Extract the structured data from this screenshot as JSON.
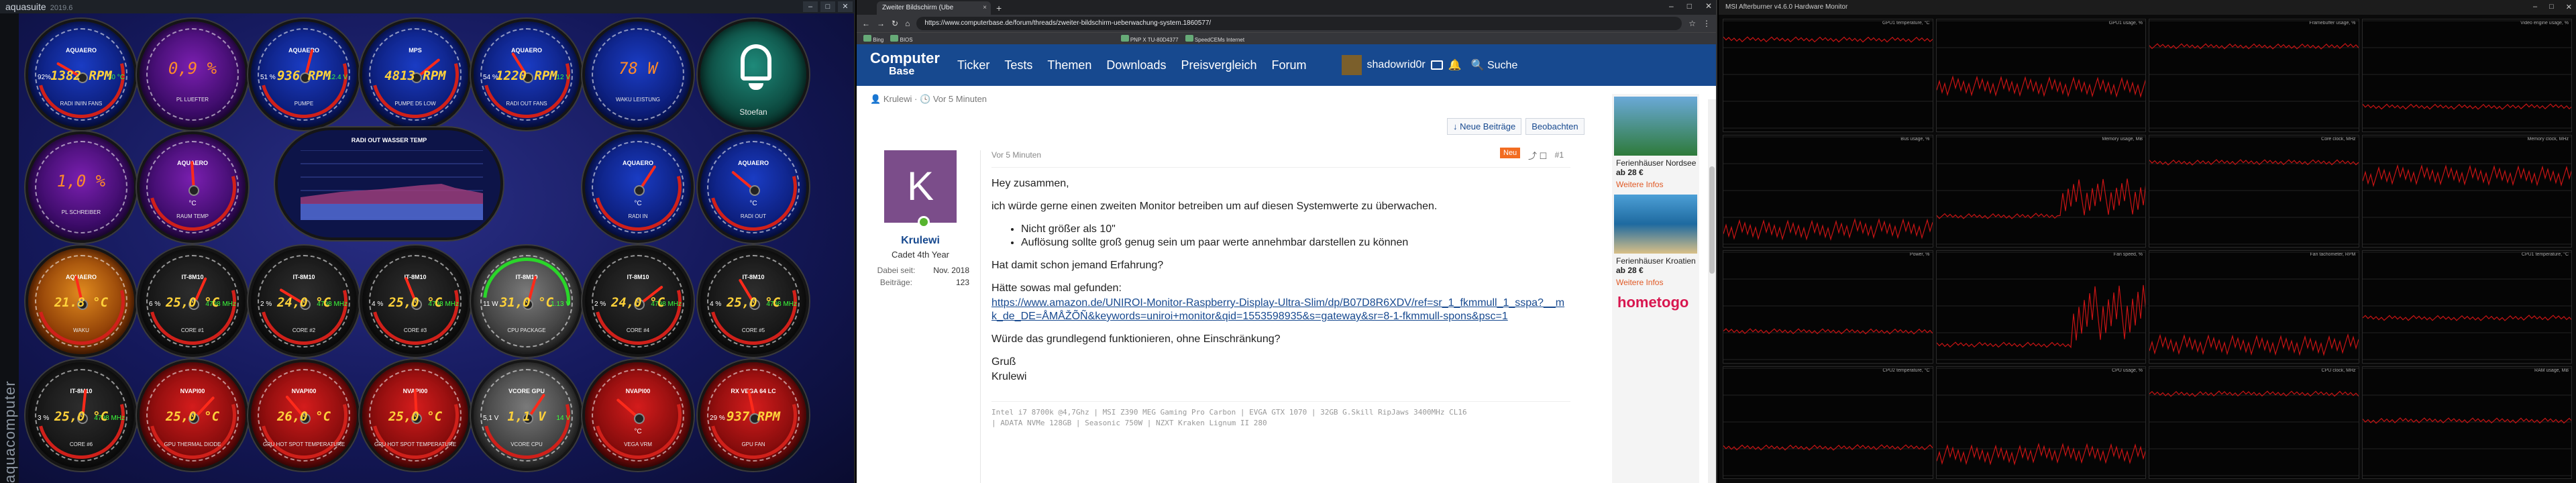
{
  "aquasuite": {
    "title": "aquasuite",
    "version": "2019.6",
    "brand": "aquacomputer",
    "graph_title": "RADI OUT WASSER TEMP",
    "gauges": [
      {
        "id": "radi-in-temp",
        "label": "AQUAERO",
        "value": "1382 RPM",
        "unit": "",
        "sub": "RADI IN/IN FANS",
        "style": "blue",
        "left": "92%",
        "right": "30 °C"
      },
      {
        "id": "pl-luefter",
        "label": "",
        "value": "0,9 %",
        "unit": "",
        "sub": "PL LUEFTER",
        "style": "purple",
        "text": true
      },
      {
        "id": "pumpe1",
        "label": "AQUAERO",
        "value": "936 RPM",
        "unit": "",
        "sub": "PUMPE",
        "style": "blue",
        "left": "51 %",
        "right": "12.4 V"
      },
      {
        "id": "pumpe-fan",
        "label": "MPS",
        "value": "4813 RPM",
        "unit": "",
        "sub": "PUMPE D5 LOW",
        "style": "blue",
        "left": "",
        "right": ""
      },
      {
        "id": "radi-fans",
        "label": "AQUAERO",
        "value": "1220 RPM",
        "unit": "",
        "sub": "RADI OUT FANS",
        "style": "blue",
        "left": "54 %",
        "right": "12 V"
      },
      {
        "id": "leistung",
        "label": "",
        "value": "78 W",
        "unit": "",
        "sub": "WAKU LEISTUNG",
        "style": "blue",
        "text": true
      },
      {
        "id": "stoefan",
        "label": "",
        "value": "",
        "unit": "",
        "sub": "Stoefan",
        "style": "teal",
        "bell": true
      },
      {
        "id": "pl-schreiber",
        "label": "",
        "value": "1,0 %",
        "unit": "",
        "sub": "PL SCHREIBER",
        "style": "purple",
        "text": true
      },
      {
        "id": "raumtemp",
        "label": "AQUAERO",
        "value": "",
        "unit": "°C",
        "sub": "RAUM TEMP",
        "style": "purple"
      },
      {
        "id": "radi-in",
        "label": "AQUAERO",
        "value": "",
        "unit": "°C",
        "sub": "RADI IN",
        "style": "blue"
      },
      {
        "id": "radi-out",
        "label": "AQUAERO",
        "value": "",
        "unit": "°C",
        "sub": "RADI OUT",
        "style": "blue"
      },
      {
        "id": "water-out",
        "label": "AQUAERO",
        "value": "21.8 °C",
        "unit": "",
        "sub": "WAKU",
        "style": "orange"
      },
      {
        "id": "core1",
        "label": "IT-8M10",
        "value": "25,0 °C",
        "unit": "",
        "sub": "CORE #1",
        "style": "dark",
        "left": "6 %",
        "right": "4798 MHz"
      },
      {
        "id": "core2",
        "label": "IT-8M10",
        "value": "24,0 °C",
        "unit": "",
        "sub": "CORE #2",
        "style": "dark",
        "left": "2 %",
        "right": "4798 MHz"
      },
      {
        "id": "core3",
        "label": "IT-8M10",
        "value": "25,0 °C",
        "unit": "",
        "sub": "CORE #3",
        "style": "dark",
        "left": "4 %",
        "right": "4798 MHz"
      },
      {
        "id": "cpu-package",
        "label": "IT-8M10",
        "value": "31,0 °C",
        "unit": "",
        "sub": "CPU PACKAGE",
        "style": "grey",
        "left": "11 W",
        "right": "1.13 V"
      },
      {
        "id": "core4",
        "label": "IT-8M10",
        "value": "24,0 °C",
        "unit": "",
        "sub": "CORE #4",
        "style": "dark",
        "left": "2 %",
        "right": "4798 MHz"
      },
      {
        "id": "core5",
        "label": "IT-8M10",
        "value": "25,0 °C",
        "unit": "",
        "sub": "CORE #5",
        "style": "dark",
        "left": "4 %",
        "right": "4798 MHz"
      },
      {
        "id": "core6",
        "label": "IT-8M10",
        "value": "25,0 °C",
        "unit": "",
        "sub": "CORE #6",
        "style": "dark",
        "left": "3 %",
        "right": "4798 MHz"
      },
      {
        "id": "gpu-thermal",
        "label": "NVAPI00",
        "value": "25,0 °C",
        "unit": "",
        "sub": "GPU THERMAL DIODE",
        "style": "red"
      },
      {
        "id": "gpu-hotspot",
        "label": "NVAPI00",
        "value": "26,0 °C",
        "unit": "",
        "sub": "GPU HOT SPOT TEMPERATURE",
        "style": "red"
      },
      {
        "id": "gpu-hotspot2",
        "label": "NVAPI00",
        "value": "25,0 °C",
        "unit": "",
        "sub": "GPU HOT SPOT TEMPERATURE",
        "style": "red"
      },
      {
        "id": "vcore",
        "label": "VCORE GPU",
        "value": "1,1 V",
        "unit": "",
        "sub": "VCORE CPU",
        "style": "grey",
        "left": "5,1 V",
        "right": "14 V"
      },
      {
        "id": "vega-vrm",
        "label": "NVAPI00",
        "value": "",
        "unit": "°C",
        "sub": "VEGA VRM",
        "style": "red"
      },
      {
        "id": "gpu-fan",
        "label": "RX VEGA 64 LC",
        "value": "937 RPM",
        "unit": "",
        "sub": "GPU FAN",
        "style": "red",
        "left": "29 %",
        "right": ""
      },
      {
        "id": "gpu-liquid",
        "label": "NVAPI00",
        "value": "26,0 °C",
        "unit": "",
        "sub": "GPU LIQUID TEMPERATURE",
        "style": "red"
      }
    ]
  },
  "browser": {
    "tab1": "Zweiter Bildschirm (Ube",
    "newtab": "+",
    "url": "https://www.computerbase.de/forum/threads/zweiter-bildschirm-ueberwachung-system.1860577/",
    "bookmarks": [
      "Bing",
      "BIOS",
      "PNP X TU-80D4377",
      "SpeedCEMs Internet"
    ],
    "logo_line1": "Computer",
    "logo_line2": "Base",
    "nav": [
      "Ticker",
      "Tests",
      "Themen",
      "Downloads",
      "Preisvergleich",
      "Forum"
    ],
    "user": "shadowrid0r",
    "search": "Suche",
    "crumb_user": "Krulewi",
    "crumb_time": "Vor 5 Minuten",
    "btn_new": "↓ Neue Beiträge",
    "btn_watch": "Beobachten",
    "author": {
      "initial": "K",
      "name": "Krulewi",
      "rank": "Cadet 4th Year",
      "joined_label": "Dabei seit:",
      "joined": "Nov. 2018",
      "posts_label": "Beiträge:",
      "posts": "123"
    },
    "post_time": "Vor 5 Minuten",
    "badge": "Neu",
    "post_no": "#1",
    "p1": "Hey zusammen,",
    "p2": "ich würde gerne einen zweiten Monitor betreiben um auf diesen Systemwerte zu überwachen.",
    "li1": "Nicht größer als 10\"",
    "li2": "Auflösung sollte groß genug sein um paar werte annehmbar darstellen zu können",
    "p3": "Hat damit schon jemand Erfahrung?",
    "p4": "Hätte sowas mal gefunden:",
    "link": "https://www.amazon.de/UNIROI-Monitor-Raspberry-Display-Ultra-Slim/dp/B07D8R6XDV/ref=sr_1_fkmmull_1_sspa?__mk_de_DE=ÅMÅŽÕÑ&keywords=uniroi+monitor&qid=1553598935&s=gateway&sr=8-1-fkmmull-spons&psc=1",
    "p5": "Würde das grundlegend funktionieren, ohne Einschränkung?",
    "p6": "Gruß",
    "p7": "Krulewi",
    "sig1": "Intel i7 8700k @4,7Ghz | MSI Z390 MEG Gaming Pro Carbon | EVGA GTX 1070 | 32GB G.Skill RipJaws 3400MHz CL16",
    "sig2": "| ADATA NVMe 128GB | Seasonic 750W | NZXT Kraken Lignum II 280",
    "ad": [
      {
        "t": "Ferienhäuser Nordsee",
        "p": "ab 28 €",
        "l": "Weitere Infos"
      },
      {
        "t": "Ferienhäuser Kroatien",
        "p": "ab 28 €",
        "l": "Weitere Infos"
      }
    ],
    "hometogo": "hometogo"
  },
  "hwmon": {
    "title": "MSI Afterburner v4.6.0 Hardware Monitor",
    "cells": [
      "GPU1 temperature, °C",
      "GPU1 usage, %",
      "Framebuffer usage, %",
      "Video engine usage, %",
      "Bus usage, %",
      "Memory usage, MB",
      "Core clock, MHz",
      "Memory clock, MHz",
      "Power, %",
      "Fan speed, %",
      "Fan tachometer, RPM",
      "CPU1 temperature, °C",
      "CPU2 temperature, °C",
      "CPU usage, %",
      "CPU clock, MHz",
      "RAM usage, MB"
    ]
  }
}
